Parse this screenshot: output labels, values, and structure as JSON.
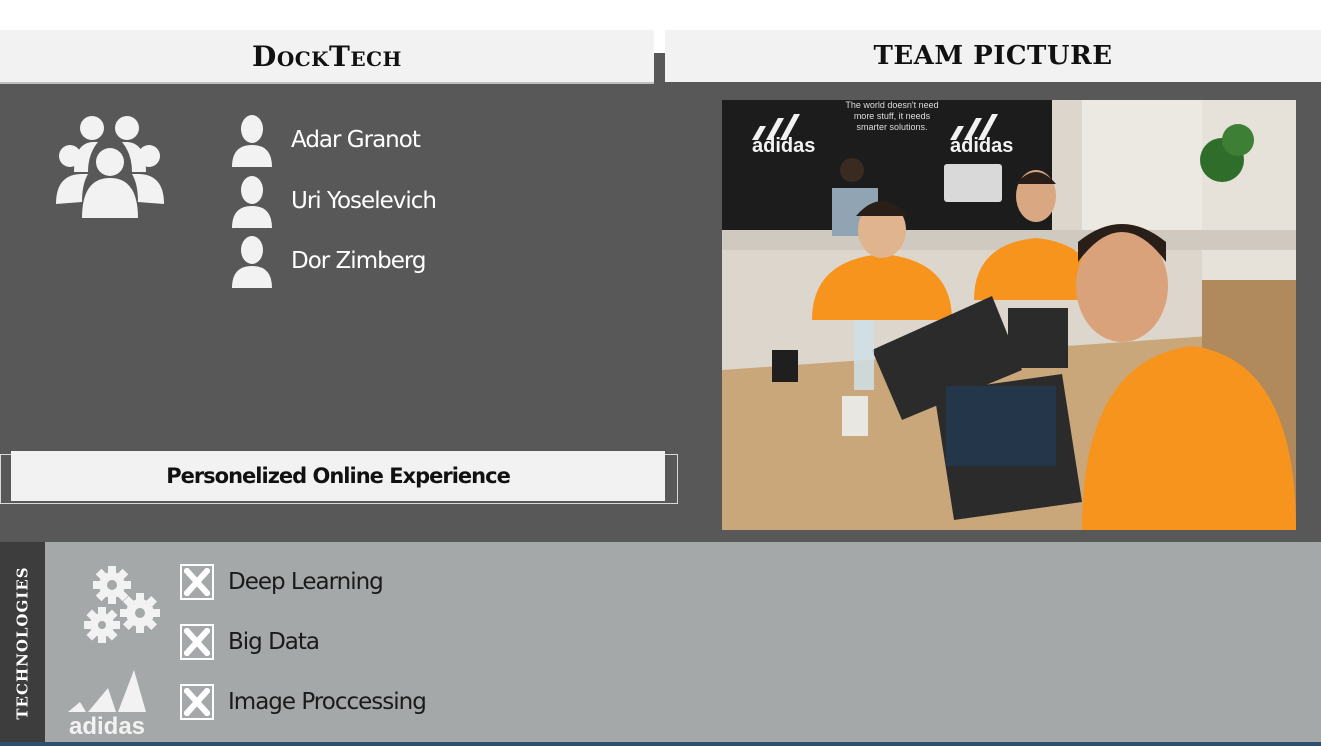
{
  "header": {
    "project_name": "DockTech",
    "team_picture_label": "TEAM PICTURE"
  },
  "team": {
    "icon": "group-icon",
    "members": [
      {
        "name": "Adar Granot",
        "icon": "person-icon"
      },
      {
        "name": "Uri Yoselevich",
        "icon": "person-icon"
      },
      {
        "name": "Dor  Zimberg",
        "icon": "person-icon"
      }
    ]
  },
  "subtitle": "Personelized Online Experience",
  "photo": {
    "poster_text": "The world doesn't need more stuff, it needs smarter solutions.",
    "brand": "adidas"
  },
  "technologies": {
    "label": "TECHNOLOGIES",
    "icons": [
      "gears-icon",
      "adidas-logo"
    ],
    "brand": "adidas",
    "items": [
      {
        "label": "Deep Learning",
        "checked": true
      },
      {
        "label": "Big Data",
        "checked": true
      },
      {
        "label": "Image Proccessing",
        "checked": true
      }
    ]
  },
  "colors": {
    "panel_dark": "#585858",
    "panel_light": "#a5a8a8",
    "tech_bar": "#3d3d3d",
    "header_bg": "#f2f2f2",
    "shirt_orange": "#f7941d"
  }
}
